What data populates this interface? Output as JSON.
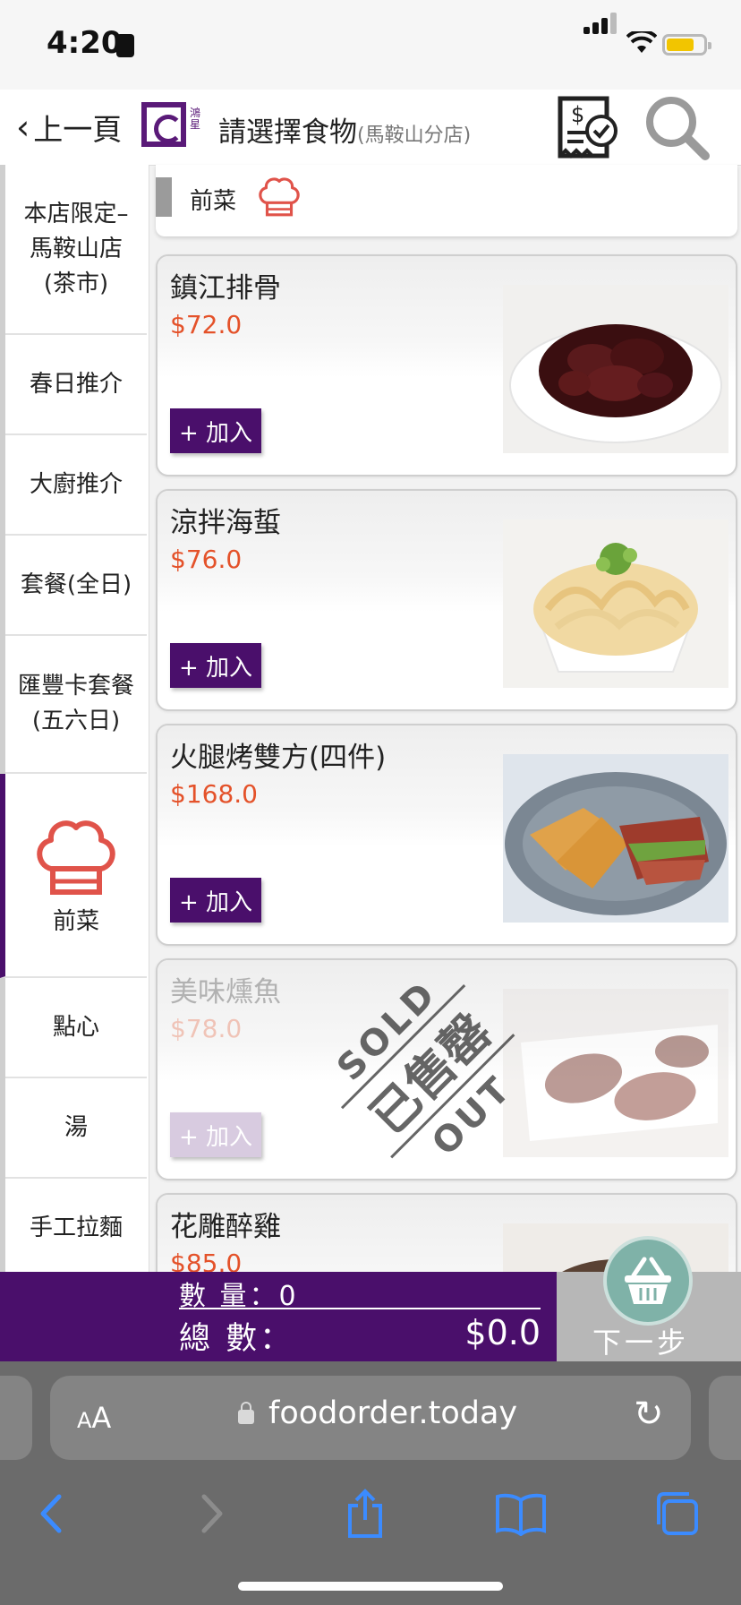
{
  "status": {
    "time": "4:20"
  },
  "header": {
    "back_label": "上一頁",
    "title": "請選擇食物",
    "store": "(馬鞍山分店)",
    "logo_text": "鴻星"
  },
  "sidebar": {
    "items": [
      {
        "label": "本店限定–馬鞍山店(茶市)"
      },
      {
        "label": "春日推介"
      },
      {
        "label": "大廚推介"
      },
      {
        "label": "套餐(全日)"
      },
      {
        "label": "匯豐卡套餐(五六日)"
      },
      {
        "label": "前菜",
        "active": true
      },
      {
        "label": "點心"
      },
      {
        "label": "湯"
      },
      {
        "label": "手工拉麵"
      }
    ]
  },
  "section": {
    "label": "前菜"
  },
  "menu": {
    "add_label": "+ 加入",
    "items": [
      {
        "name": "鎮江排骨",
        "price": "$72.0",
        "sold_out": false
      },
      {
        "name": "涼拌海蜇",
        "price": "$76.0",
        "sold_out": false
      },
      {
        "name": "火腿烤雙方(四件)",
        "price": "$168.0",
        "sold_out": false
      },
      {
        "name": "美味燻魚",
        "price": "$78.0",
        "sold_out": true
      },
      {
        "name": "花雕醉雞",
        "price": "$85.0",
        "sold_out": false
      }
    ],
    "sold_out_text": {
      "top": "SOLD",
      "middle": "已售罄",
      "bottom": "OUT"
    }
  },
  "cart": {
    "qty_label": "數 量：",
    "qty": "0",
    "total_label": "總 數：",
    "total": "$0.0",
    "next_label": "下一步"
  },
  "browser": {
    "aa_big": "A",
    "aa_small": "A",
    "url": "foodorder.today"
  },
  "colors": {
    "brand": "#4a0f6b",
    "price": "#e4522a",
    "accent_hat": "#e0534a"
  }
}
